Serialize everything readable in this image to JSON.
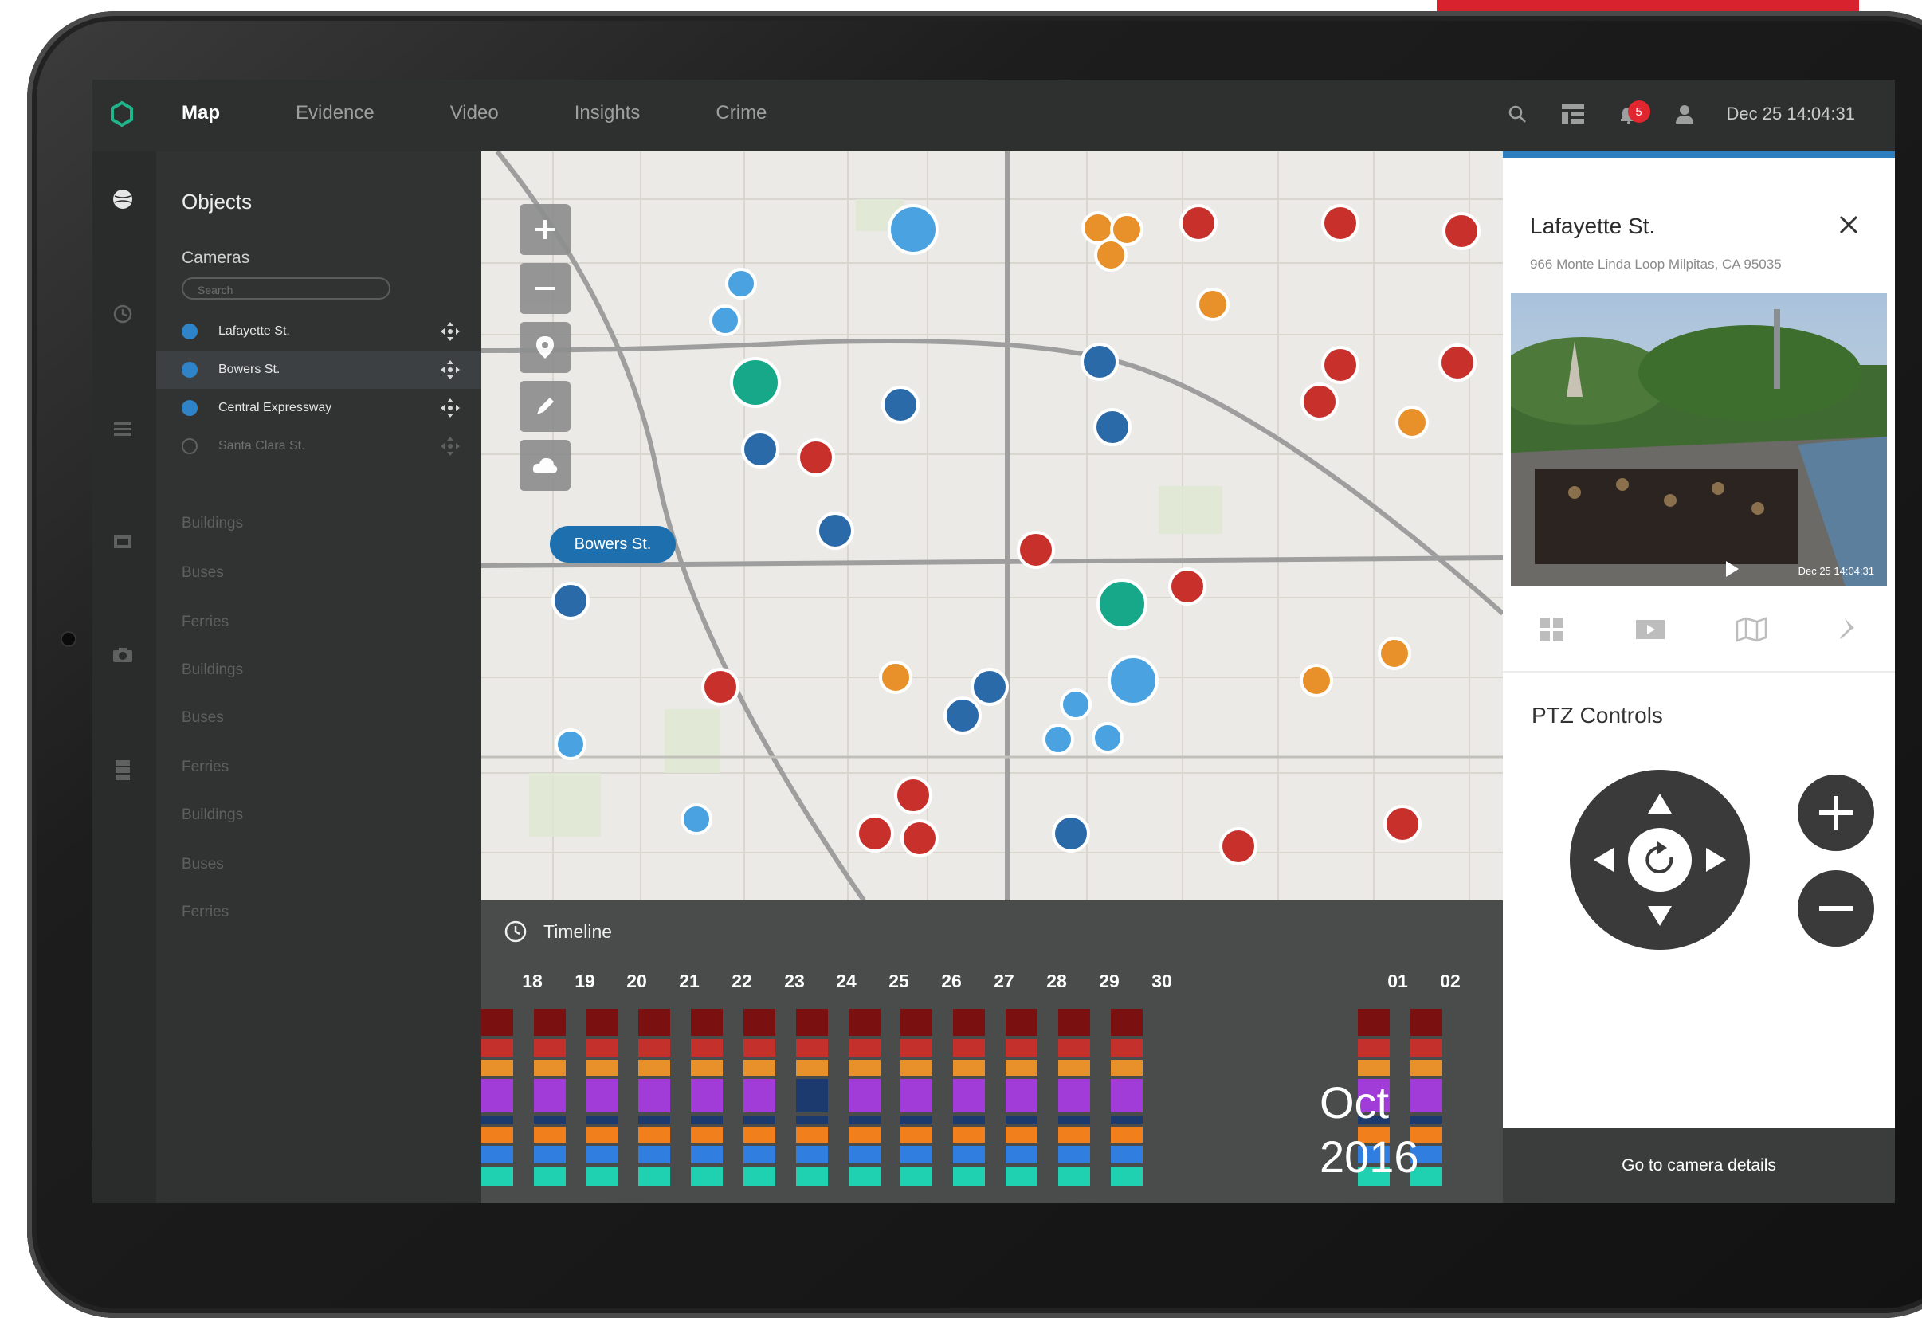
{
  "nav": {
    "items": [
      {
        "label": "Map",
        "active": true
      },
      {
        "label": "Evidence",
        "active": false
      },
      {
        "label": "Video",
        "active": false
      },
      {
        "label": "Insights",
        "active": false
      },
      {
        "label": "Crime",
        "active": false
      }
    ],
    "notification_count": "5",
    "datetime": "Dec 25 14:04:31"
  },
  "objects": {
    "title": "Objects",
    "cameras_label": "Cameras",
    "search_placeholder": "Search",
    "cameras": [
      {
        "name": "Lafayette St.",
        "color": "#2f83c8",
        "selected": false,
        "enabled": true
      },
      {
        "name": "Bowers St.",
        "color": "#2f83c8",
        "selected": true,
        "enabled": true
      },
      {
        "name": "Central Expressway",
        "color": "#2f83c8",
        "selected": false,
        "enabled": true
      },
      {
        "name": "Santa Clara St.",
        "color": "",
        "selected": false,
        "enabled": false
      }
    ],
    "categories": [
      "Buildings",
      "Buses",
      "Ferries",
      "Buildings",
      "Buses",
      "Ferries",
      "Buildings",
      "Buses",
      "Ferries"
    ]
  },
  "map": {
    "selected_label": "Bowers St."
  },
  "timeline": {
    "title": "Timeline",
    "days": [
      "18",
      "19",
      "20",
      "21",
      "22",
      "23",
      "24",
      "25",
      "26",
      "27",
      "28",
      "29",
      "30",
      "01",
      "02"
    ],
    "month": "Oct",
    "year": "2016"
  },
  "camera_panel": {
    "title": "Lafayette St.",
    "address": "966 Monte Linda Loop Milpitas, CA 95035",
    "timestamp": "Dec 25 14:04:31",
    "ptz_title": "PTZ Controls",
    "footer_button": "Go to camera details"
  },
  "colors": {
    "accent": "#2d7fbf",
    "alert_red": "#c8302b",
    "bus_orange": "#e8912a",
    "camera_blue": "#2a6aa8",
    "twitter_blue": "#4aa3e0",
    "photo_teal": "#17a88a"
  }
}
